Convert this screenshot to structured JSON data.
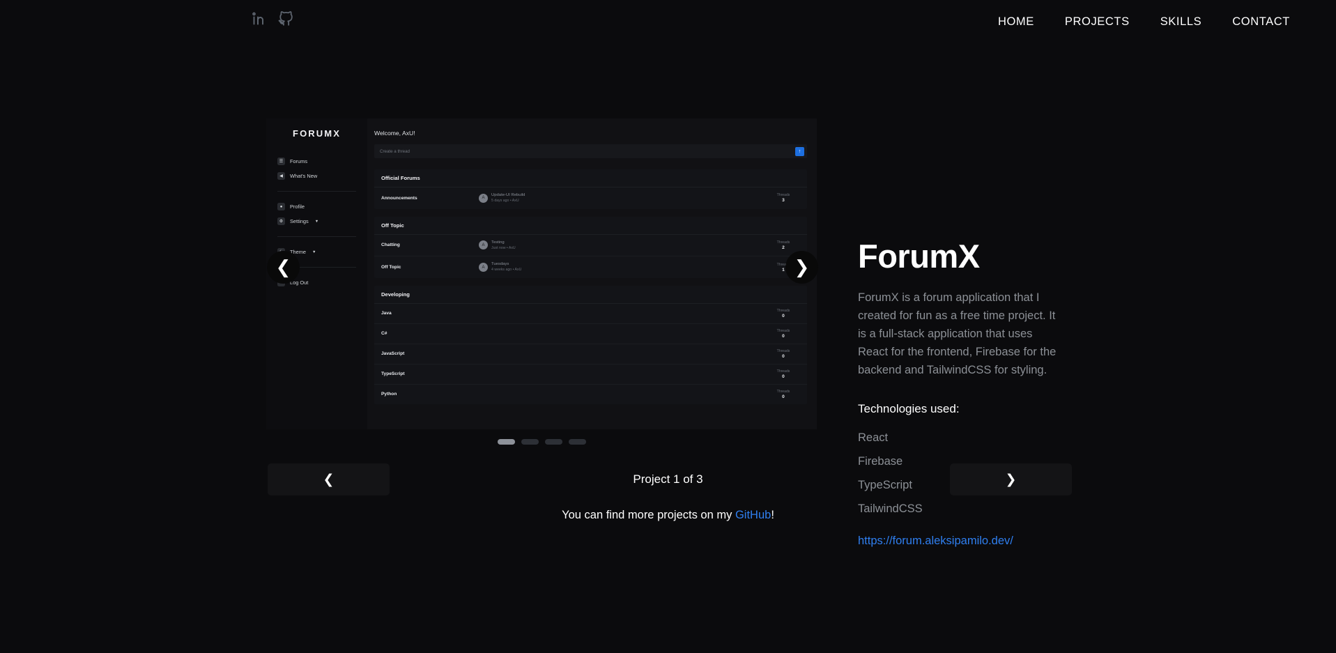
{
  "topbar": {
    "socials": [
      {
        "name": "linkedin-icon",
        "label": "LinkedIn"
      },
      {
        "name": "github-icon",
        "label": "GitHub"
      }
    ],
    "nav": [
      {
        "label": "HOME"
      },
      {
        "label": "PROJECTS"
      },
      {
        "label": "SKILLS"
      },
      {
        "label": "CONTACT"
      }
    ]
  },
  "carousel": {
    "prev_arrow": "‹",
    "next_arrow": "›",
    "prev_round": "‹",
    "next_round": "›",
    "dots": [
      {
        "active": true
      },
      {
        "active": false
      },
      {
        "active": false
      },
      {
        "active": false
      }
    ],
    "pager_label": "Project 1 of 3",
    "current": 1,
    "total": 3
  },
  "project": {
    "title": "ForumX",
    "description": "ForumX is a forum application that I created for fun as a free time project. It is a full-stack application that uses React for the frontend, Firebase for the backend and TailwindCSS for styling.",
    "tech_heading": "Technologies used:",
    "technologies": [
      "React",
      "Firebase",
      "TypeScript",
      "TailwindCSS"
    ],
    "link_text": "https://forum.aleksipamilo.dev/",
    "link_color": "#2f7ff0"
  },
  "screenshot": {
    "app_name": "FORUMX",
    "sidebar": [
      {
        "label": "Forums",
        "icon": "forums-icon",
        "glyph": "☰",
        "caret": false
      },
      {
        "label": "What's New",
        "icon": "megaphone-icon",
        "glyph": "◀",
        "caret": false
      },
      {
        "label": "Profile",
        "icon": "user-icon",
        "glyph": "●",
        "caret": false
      },
      {
        "label": "Settings",
        "icon": "gear-icon",
        "glyph": "⚙",
        "caret": true
      },
      {
        "label": "Theme",
        "icon": "moon-icon",
        "glyph": "☾",
        "caret": true
      },
      {
        "label": "Log Out",
        "icon": "logout-icon",
        "glyph": "⏻",
        "caret": false
      }
    ],
    "welcome": "Welcome, AxU!",
    "compose_placeholder": "Create a thread",
    "compose_button_glyph": "⬆",
    "threads_label": "Threads",
    "sections": [
      {
        "title": "Official Forums",
        "rows": [
          {
            "name": "Announcements",
            "avatar": "A",
            "latest_title": "Update-UI Rebuild",
            "latest_meta": "5 days ago • AxU",
            "threads": "3"
          }
        ]
      },
      {
        "title": "Off Topic",
        "rows": [
          {
            "name": "Chatting",
            "avatar": "A",
            "latest_title": "Testing",
            "latest_meta": "Just now • AxU",
            "threads": "2"
          },
          {
            "name": "Off Topic",
            "avatar": "A",
            "latest_title": "Tuesdays",
            "latest_meta": "4 weeks ago • AxU",
            "threads": "1"
          }
        ]
      },
      {
        "title": "Developing",
        "rows": [
          {
            "name": "Java",
            "avatar": "",
            "latest_title": "",
            "latest_meta": "",
            "threads": "0"
          },
          {
            "name": "C#",
            "avatar": "",
            "latest_title": "",
            "latest_meta": "",
            "threads": "0"
          },
          {
            "name": "JavaScript",
            "avatar": "",
            "latest_title": "",
            "latest_meta": "",
            "threads": "0"
          },
          {
            "name": "TypeScript",
            "avatar": "",
            "latest_title": "",
            "latest_meta": "",
            "threads": "0"
          },
          {
            "name": "Python",
            "avatar": "",
            "latest_title": "",
            "latest_meta": "",
            "threads": "0"
          }
        ]
      }
    ]
  },
  "footer": {
    "text_before": "You can find more projects on my ",
    "link_text": "GitHub",
    "text_after": "!"
  },
  "colors": {
    "page_bg": "#0b0b0d",
    "accent_blue": "#2f7ff0",
    "muted_text": "#8c9096"
  }
}
